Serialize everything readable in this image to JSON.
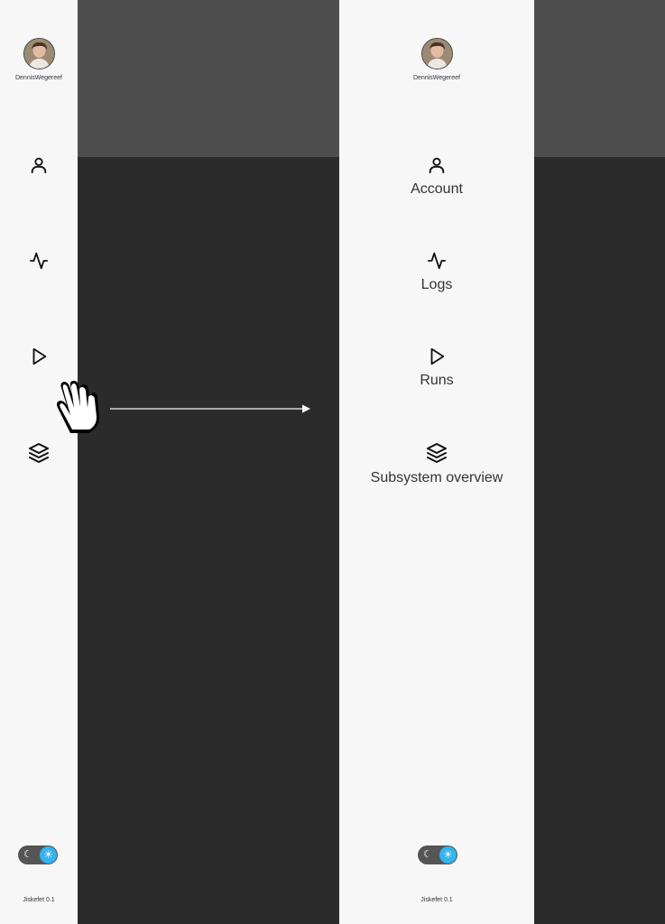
{
  "user": {
    "name": "DennisWegereef"
  },
  "nav": {
    "account": {
      "label": "Account",
      "icon": "user-icon"
    },
    "logs": {
      "label": "Logs",
      "icon": "activity-icon"
    },
    "runs": {
      "label": "Runs",
      "icon": "play-icon"
    },
    "subsystem_overview": {
      "label": "Subsystem overview",
      "icon": "layers-icon"
    }
  },
  "theme_toggle": {
    "moon_icon": "☾",
    "sun_icon": "☀",
    "accent": "#33b3f0"
  },
  "app": {
    "version": "Jiskefet 0.1"
  },
  "colors": {
    "sidebar_bg": "#f7f7f7",
    "backdrop_dark": "#2b2b2b",
    "backdrop_top": "#4e4e4e"
  }
}
